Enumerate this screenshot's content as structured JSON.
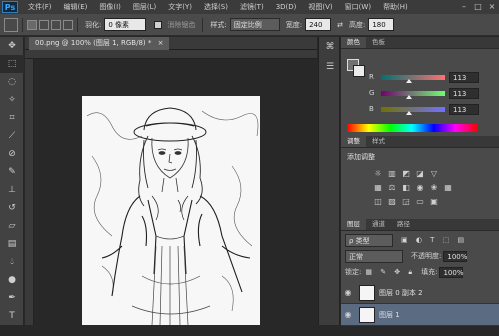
{
  "app": {
    "logo": "Ps"
  },
  "menu": [
    "文件(F)",
    "编辑(E)",
    "图像(I)",
    "图层(L)",
    "文字(Y)",
    "选择(S)",
    "滤镜(T)",
    "3D(D)",
    "视图(V)",
    "窗口(W)",
    "帮助(H)"
  ],
  "window_controls": [
    "–",
    "□",
    "×"
  ],
  "options": {
    "feather_label": "羽化:",
    "feather_value": "0 像素",
    "antialias_label": "消除锯齿",
    "style_label": "样式:",
    "style_value": "固定比例",
    "width_label": "宽度:",
    "width_value": "240",
    "height_label": "高度:",
    "height_value": "180"
  },
  "document": {
    "tab_title": "00.png @ 100% (图层 1, RGB/8) *",
    "tab_close": "×"
  },
  "color_panel": {
    "tabs": [
      "颜色",
      "色板"
    ],
    "channels": [
      {
        "label": "R",
        "value": "113",
        "fraction": 0.44,
        "gradient": "linear-gradient(to right, #007171, #ff7171)"
      },
      {
        "label": "G",
        "value": "113",
        "fraction": 0.44,
        "gradient": "linear-gradient(to right, #710071, #71ff71)"
      },
      {
        "label": "B",
        "value": "113",
        "fraction": 0.44,
        "gradient": "linear-gradient(to right, #717100, #7171ff)"
      }
    ],
    "foreground": "#717171",
    "background": "#ececec"
  },
  "adjust_panel": {
    "tabs": [
      "调整",
      "样式"
    ],
    "title": "添加调整",
    "rows": [
      [
        "sun-icon",
        "levels-icon",
        "curves-icon",
        "exposure-icon",
        "triangle-icon"
      ],
      [
        "hue-icon",
        "balance-icon",
        "bw-icon",
        "camera-icon",
        "lookup-icon",
        "grid-icon"
      ],
      [
        "invert-icon",
        "posterize-icon",
        "threshold-icon",
        "gradient-map-icon",
        "selective-color-icon"
      ]
    ]
  },
  "layers_panel": {
    "tabs": [
      "图层",
      "通道",
      "路径"
    ],
    "filter_label": "ρ 类型",
    "blend_mode": "正常",
    "opacity_label": "不透明度:",
    "opacity_value": "100%",
    "lock_label": "锁定:",
    "fill_label": "填充:",
    "fill_value": "100%",
    "layers": [
      {
        "name": "图层 0 副本 2",
        "selected": false
      },
      {
        "name": "图层 1",
        "selected": true
      }
    ]
  }
}
